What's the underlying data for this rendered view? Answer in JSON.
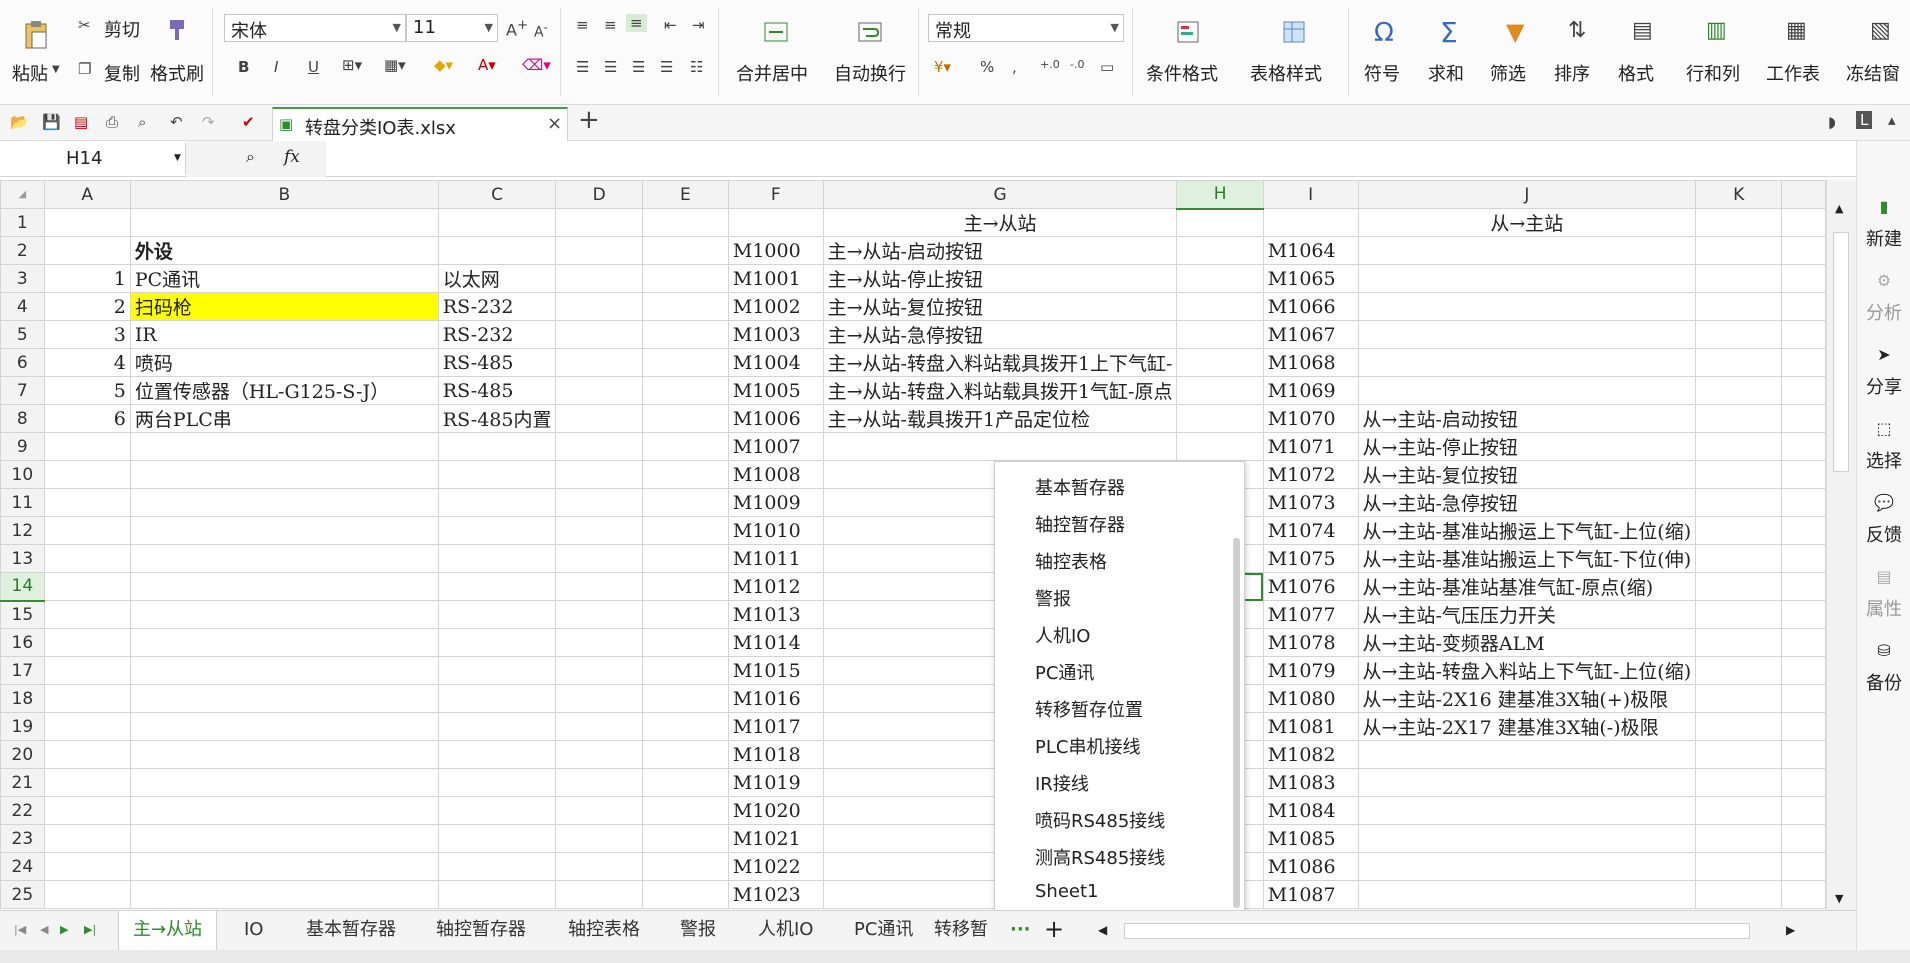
{
  "ribbon": {
    "paste": "粘贴",
    "cut": "剪切",
    "copy": "复制",
    "format_painter": "格式刷",
    "font_name": "宋体",
    "font_size": "11",
    "merge_center": "合并居中",
    "wrap_text": "自动换行",
    "number_format": "常规",
    "conditional_format": "条件格式",
    "table_style": "表格样式",
    "symbol": "符号",
    "sum": "求和",
    "filter": "筛选",
    "sort": "排序",
    "format": "格式",
    "rows_cols": "行和列",
    "worksheet": "工作表",
    "freeze": "冻结窗"
  },
  "file": {
    "tab_name": "转盘分类IO表.xlsx"
  },
  "formula_bar": {
    "cell_ref": "H14",
    "fx": "fx",
    "value": ""
  },
  "columns": [
    "A",
    "B",
    "C",
    "D",
    "E",
    "F",
    "G",
    "H",
    "I",
    "J",
    "K"
  ],
  "rows": [
    {
      "n": "1",
      "A": "",
      "B": "",
      "C": "",
      "F": "",
      "G": "主→从站",
      "I": "",
      "J": "从→主站"
    },
    {
      "n": "2",
      "A": "",
      "B": "外设",
      "C": "",
      "F": "M1000",
      "G": "主→从站-启动按钮",
      "I": "M1064",
      "J": ""
    },
    {
      "n": "3",
      "A": "1",
      "B": "PC通讯",
      "C": "以太网",
      "F": "M1001",
      "G": "主→从站-停止按钮",
      "I": "M1065",
      "J": ""
    },
    {
      "n": "4",
      "A": "2",
      "B": "扫码枪",
      "C": "RS-232",
      "F": "M1002",
      "G": "主→从站-复位按钮",
      "I": "M1066",
      "J": ""
    },
    {
      "n": "5",
      "A": "3",
      "B": "IR",
      "C": "RS-232",
      "F": "M1003",
      "G": "主→从站-急停按钮",
      "I": "M1067",
      "J": ""
    },
    {
      "n": "6",
      "A": "4",
      "B": "喷码",
      "C": "RS-485",
      "F": "M1004",
      "G": "主→从站-转盘入料站载具拨开1上下气缸-",
      "I": "M1068",
      "J": ""
    },
    {
      "n": "7",
      "A": "5",
      "B": "位置传感器（HL-G125-S-J）",
      "C": "RS-485",
      "F": "M1005",
      "G": "主→从站-转盘入料站载具拨开1气缸-原点",
      "I": "M1069",
      "J": ""
    },
    {
      "n": "8",
      "A": "6",
      "B": "两台PLC串",
      "C": "RS-485内置",
      "F": "M1006",
      "G": "主→从站-载具拨开1产品定位检",
      "I": "M1070",
      "J": "从→主站-启动按钮"
    },
    {
      "n": "9",
      "A": "",
      "B": "",
      "C": "",
      "F": "M1007",
      "G": "",
      "I": "M1071",
      "J": "从→主站-停止按钮"
    },
    {
      "n": "10",
      "A": "",
      "B": "",
      "C": "",
      "F": "M1008",
      "G": "",
      "I": "M1072",
      "J": "从→主站-复位按钮"
    },
    {
      "n": "11",
      "A": "",
      "B": "",
      "C": "",
      "F": "M1009",
      "G": "",
      "I": "M1073",
      "J": "从→主站-急停按钮"
    },
    {
      "n": "12",
      "A": "",
      "B": "",
      "C": "",
      "F": "M1010",
      "G": "",
      "I": "M1074",
      "J": "从→主站-基准站搬运上下气缸-上位(缩)"
    },
    {
      "n": "13",
      "A": "",
      "B": "",
      "C": "",
      "F": "M1011",
      "G": "",
      "I": "M1075",
      "J": "从→主站-基准站搬运上下气缸-下位(伸)"
    },
    {
      "n": "14",
      "A": "",
      "B": "",
      "C": "",
      "F": "M1012",
      "G": "",
      "I": "M1076",
      "J": "从→主站-基准站基准气缸-原点(缩)"
    },
    {
      "n": "15",
      "A": "",
      "B": "",
      "C": "",
      "F": "M1013",
      "G": "",
      "I": "M1077",
      "J": "从→主站-气压压力开关"
    },
    {
      "n": "16",
      "A": "",
      "B": "",
      "C": "",
      "F": "M1014",
      "G": "",
      "I": "M1078",
      "J": "从→主站-变频器ALM"
    },
    {
      "n": "17",
      "A": "",
      "B": "",
      "C": "",
      "F": "M1015",
      "G": "",
      "I": "M1079",
      "J": "从→主站-转盘入料站上下气缸-上位(缩)"
    },
    {
      "n": "18",
      "A": "",
      "B": "",
      "C": "",
      "F": "M1016",
      "G": "",
      "I": "M1080",
      "J": "从→主站-2X16 建基准3X轴(+)极限"
    },
    {
      "n": "19",
      "A": "",
      "B": "",
      "C": "",
      "F": "M1017",
      "G": "",
      "I": "M1081",
      "J": "从→主站-2X17 建基准3X轴(-)极限"
    },
    {
      "n": "20",
      "A": "",
      "B": "",
      "C": "",
      "F": "M1018",
      "G": "",
      "I": "M1082",
      "J": ""
    },
    {
      "n": "21",
      "A": "",
      "B": "",
      "C": "",
      "F": "M1019",
      "G": "",
      "I": "M1083",
      "J": ""
    },
    {
      "n": "22",
      "A": "",
      "B": "",
      "C": "",
      "F": "M1020",
      "G": "",
      "I": "M1084",
      "J": ""
    },
    {
      "n": "23",
      "A": "",
      "B": "",
      "C": "",
      "F": "M1021",
      "G": "",
      "I": "M1085",
      "J": ""
    },
    {
      "n": "24",
      "A": "",
      "B": "",
      "C": "",
      "F": "M1022",
      "G": "",
      "I": "M1086",
      "J": ""
    },
    {
      "n": "25",
      "A": "",
      "B": "",
      "C": "",
      "F": "M1023",
      "G": "",
      "I": "M1087",
      "J": ""
    }
  ],
  "sheet_menu": [
    "基本暂存器",
    "轴控暂存器",
    "轴控表格",
    "警报",
    "人机IO",
    "PC通讯",
    "转移暂存位置",
    "PLC串机接线",
    "IR接线",
    "喷码RS485接线",
    "测高RS485接线",
    "Sheet1"
  ],
  "sheet_tabs": [
    "主→从站",
    "IO",
    "基本暂存器",
    "轴控暂存器",
    "轴控表格",
    "警报",
    "人机IO",
    "PC通讯",
    "转移暂"
  ],
  "sheet_tabs_more": "···",
  "right_panel": [
    "新建",
    "分析",
    "分享",
    "选择",
    "反馈",
    "属性",
    "备份"
  ],
  "colors": {
    "accent": "#2e8b2e",
    "highlight": "#ffff00"
  }
}
